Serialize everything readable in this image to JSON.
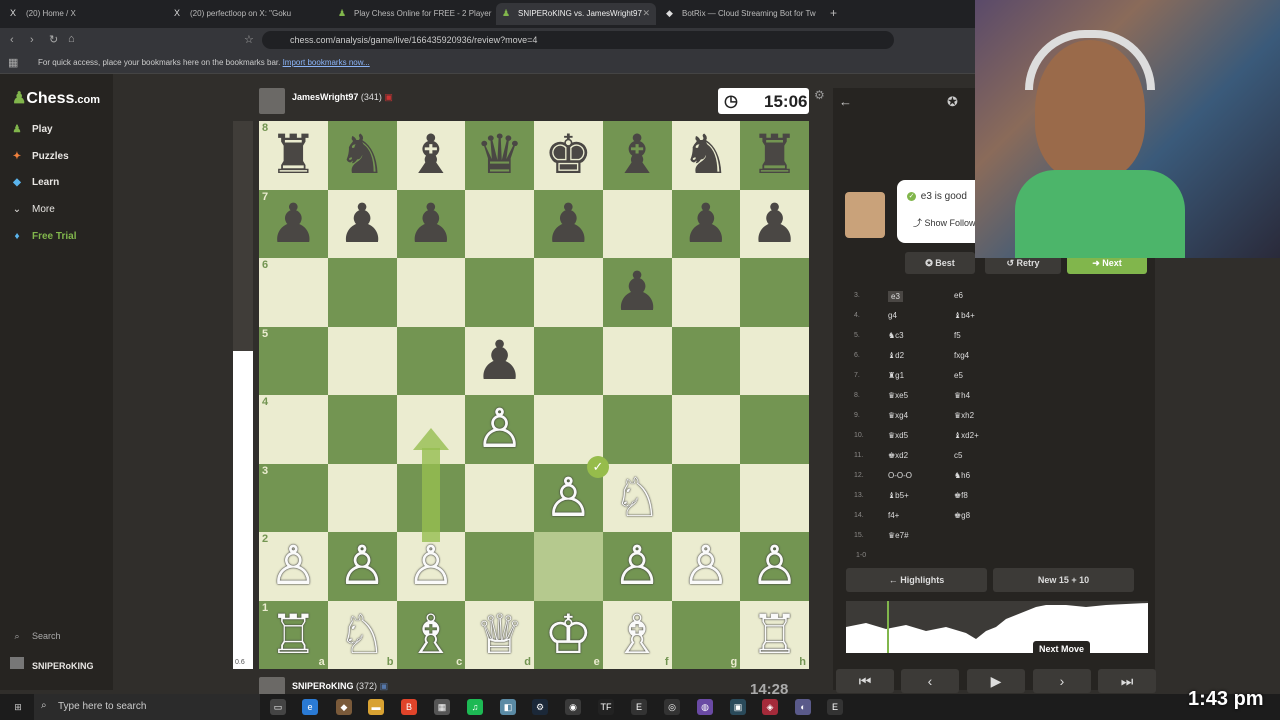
{
  "browser": {
    "tabs": [
      {
        "icon": "X",
        "label": "(20) Home / X"
      },
      {
        "icon": "X",
        "label": "(20) perfectloop on X: \"Goku"
      },
      {
        "icon": "♟",
        "label": "Play Chess Online for FREE - 2 Player"
      },
      {
        "icon": "♟",
        "label": "SNIPERoKING vs. JamesWright97"
      },
      {
        "icon": "◆",
        "label": "BotRix — Cloud Streaming Bot for Tw"
      }
    ],
    "url": "chess.com/analysis/game/live/166435920936/review?move=4",
    "bookmarks_text": "For quick access, place your bookmarks here on the bookmarks bar.",
    "bookmarks_link": "Import bookmarks now..."
  },
  "sidebar": {
    "logo": "Chess",
    "logo_suffix": ".com",
    "items": [
      {
        "label": "Play",
        "icon": "♟"
      },
      {
        "label": "Puzzles",
        "icon": "✦"
      },
      {
        "label": "Learn",
        "icon": "◆"
      },
      {
        "label": "More",
        "icon": "⌄"
      },
      {
        "label": "Free Trial",
        "icon": "♦"
      }
    ],
    "search": "Search",
    "user": "SNIPERoKING"
  },
  "players": {
    "top": {
      "name": "JamesWright97",
      "rating": "(341)",
      "clock": "15:06"
    },
    "bottom": {
      "name": "SNIPERoKING",
      "rating": "(372)",
      "clock": "14:28"
    }
  },
  "eval": {
    "text": "0.6",
    "white_fraction": 0.58
  },
  "board": {
    "ranks": [
      "8",
      "7",
      "6",
      "5",
      "4",
      "3",
      "2",
      "1"
    ],
    "files": [
      "a",
      "b",
      "c",
      "d",
      "e",
      "f",
      "g",
      "h"
    ],
    "rows": [
      [
        "♜",
        "♞",
        "♝",
        "♛",
        "♚",
        "♝",
        "♞",
        "♜"
      ],
      [
        "♟",
        "♟",
        "♟",
        "",
        "♟",
        "",
        "♟",
        "♟"
      ],
      [
        "",
        "",
        "",
        "",
        "",
        "♟",
        "",
        ""
      ],
      [
        "",
        "",
        "",
        "♟",
        "",
        "",
        "",
        ""
      ],
      [
        "",
        "",
        "",
        "♙",
        "",
        "",
        "",
        ""
      ],
      [
        "",
        "",
        "",
        "",
        "♙",
        "♘",
        "",
        ""
      ],
      [
        "♙",
        "♙",
        "♙",
        "",
        "",
        "♙",
        "♙",
        "♙"
      ],
      [
        "♖",
        "♘",
        "♗",
        "♕",
        "♔",
        "♗",
        "",
        ""
      ]
    ],
    "bottom_rank_extra": {
      "h1": "♖"
    },
    "highlight": [
      "e2",
      "e3"
    ]
  },
  "coach": {
    "message": "e3 is good",
    "follow": "Show Follow-Up"
  },
  "actions": {
    "best": "Best",
    "retry": "Retry",
    "next": "Next"
  },
  "moves": [
    {
      "n": "3.",
      "w": "e3",
      "b": "e6"
    },
    {
      "n": "4.",
      "w": "g4",
      "b": "♝b4+"
    },
    {
      "n": "5.",
      "w": "♞c3",
      "b": "f5"
    },
    {
      "n": "6.",
      "w": "♝d2",
      "b": "fxg4"
    },
    {
      "n": "7.",
      "w": "♜g1",
      "b": "e5"
    },
    {
      "n": "8.",
      "w": "♛xe5",
      "b": "♛h4"
    },
    {
      "n": "9.",
      "w": "♛xg4",
      "b": "♛xh2"
    },
    {
      "n": "10.",
      "w": "♛xd5",
      "b": "♝xd2+"
    },
    {
      "n": "11.",
      "w": "♚xd2",
      "b": "c5"
    },
    {
      "n": "12.",
      "w": "O-O-O",
      "b": "♞h6"
    },
    {
      "n": "13.",
      "w": "♝b5+",
      "b": "♚f8"
    },
    {
      "n": "14.",
      "w": "f4+",
      "b": "♚g8"
    },
    {
      "n": "15.",
      "w": "♛e7#",
      "b": ""
    }
  ],
  "result": "1-0",
  "review": {
    "highlights": "Highlights",
    "new_game": "New 15 + 10"
  },
  "tooltip": "Next Move",
  "taskbar": {
    "search": "Type here to search",
    "time": "1:43 pm"
  }
}
